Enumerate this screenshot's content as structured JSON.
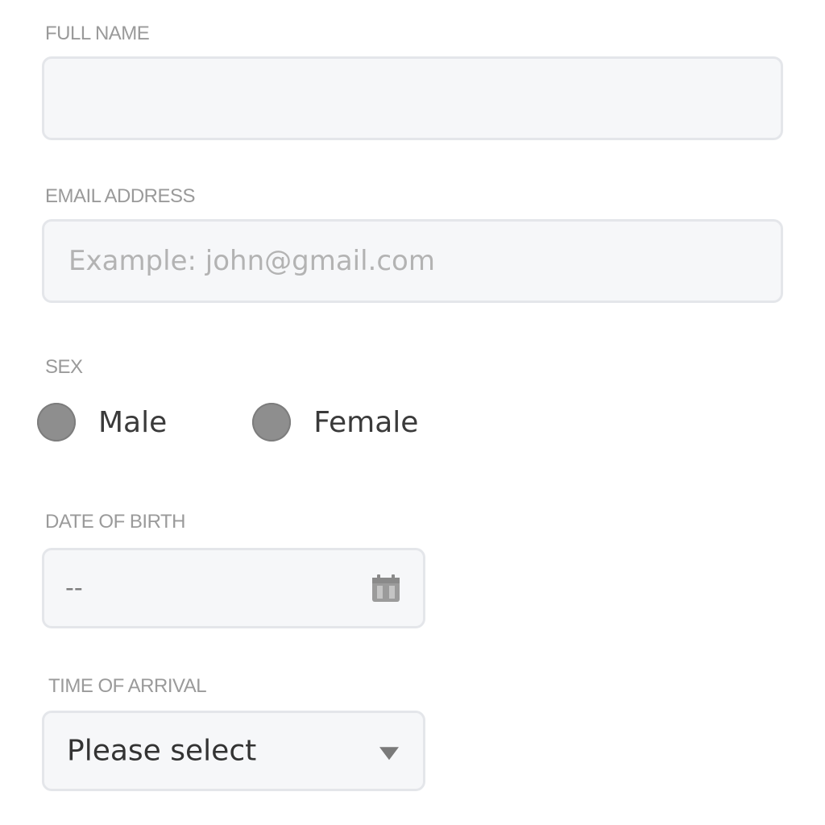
{
  "form": {
    "full_name": {
      "label": "FULL NAME",
      "value": ""
    },
    "email": {
      "label": "EMAIL ADDRESS",
      "placeholder": "Example: john@gmail.com",
      "value": ""
    },
    "sex": {
      "label": "SEX",
      "options": [
        "Male",
        "Female"
      ]
    },
    "date_of_birth": {
      "label": "DATE OF BIRTH",
      "value": "--",
      "icon": "calendar-icon"
    },
    "time_of_arrival": {
      "label": "TIME OF ARRIVAL",
      "selected": "Please select",
      "icon": "chevron-down-icon"
    }
  },
  "colors": {
    "field_bg": "#f6f7f9",
    "field_border": "#e4e6ea",
    "label": "#9a9a9a",
    "radio": "#8e8e8e"
  }
}
